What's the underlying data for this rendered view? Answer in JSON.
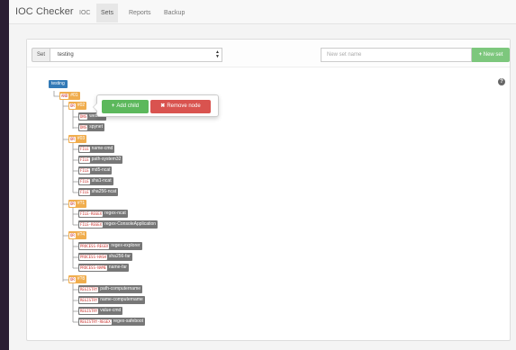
{
  "navbar": {
    "brand": "IOC Checker",
    "links": [
      {
        "label": "IOC",
        "active": false
      },
      {
        "label": "Sets",
        "active": true
      },
      {
        "label": "Reports",
        "active": false
      },
      {
        "label": "Backup",
        "active": false
      }
    ]
  },
  "toolbar": {
    "set_label": "Set",
    "set_value": "testing",
    "new_set_placeholder": "New set name",
    "new_set_button": "New set"
  },
  "popover": {
    "add_child": "Add child",
    "remove_node": "Remove node"
  },
  "tree": {
    "root": "testing",
    "and_node": {
      "op": "AND",
      "label": "#01"
    },
    "groups": [
      {
        "op": "OR",
        "label": "#02",
        "items": [
          {
            "tag": "DNS",
            "text": "websha"
          },
          {
            "tag": "DNS",
            "text": "spynet"
          }
        ]
      },
      {
        "op": "OR",
        "label": "#03",
        "items": [
          {
            "tag": "FILE",
            "text": "name-cmd"
          },
          {
            "tag": "FILE",
            "text": "path-system32"
          },
          {
            "tag": "FILE",
            "text": "md5-ncat"
          },
          {
            "tag": "FILE",
            "text": "sha1-ncat"
          },
          {
            "tag": "FILE",
            "text": "sha256-ncat"
          }
        ]
      },
      {
        "op": "OR",
        "label": "#?1",
        "items": [
          {
            "tag": "FILE-REGEX",
            "text": "regex-ncat"
          },
          {
            "tag": "FILE-REGEX",
            "text": "regex-ConsoleApplication"
          }
        ]
      },
      {
        "op": "OR",
        "label": "#?4",
        "items": [
          {
            "tag": "PROCESS-REGEX",
            "text": "regex-explorer"
          },
          {
            "tag": "PROCESS-HASH",
            "text": "sha256-far"
          },
          {
            "tag": "PROCESS-NAME",
            "text": "name-far"
          }
        ]
      },
      {
        "op": "OR",
        "label": "#?8",
        "items": [
          {
            "tag": "REGISTRY",
            "text": "path-computername"
          },
          {
            "tag": "REGISTRY",
            "text": "name-computername"
          },
          {
            "tag": "REGISTRY",
            "text": "value-cmd"
          },
          {
            "tag": "REGISTRY-REGEX",
            "text": "regex-safeboot"
          }
        ]
      }
    ]
  },
  "colors": {
    "root": "#337ab7",
    "operator": "#f0ad4e",
    "leaf": "#777777",
    "tag_text": "#c9302c",
    "add_button": "#5cb85c",
    "remove_button": "#d9534f",
    "new_set_button": "#7dc77d"
  },
  "icons": {
    "select_arrow": "chevron-updown-icon",
    "new_set": "plus-icon",
    "add_child": "plus-icon",
    "remove_node": "times-icon",
    "help": "question-circle-icon"
  }
}
